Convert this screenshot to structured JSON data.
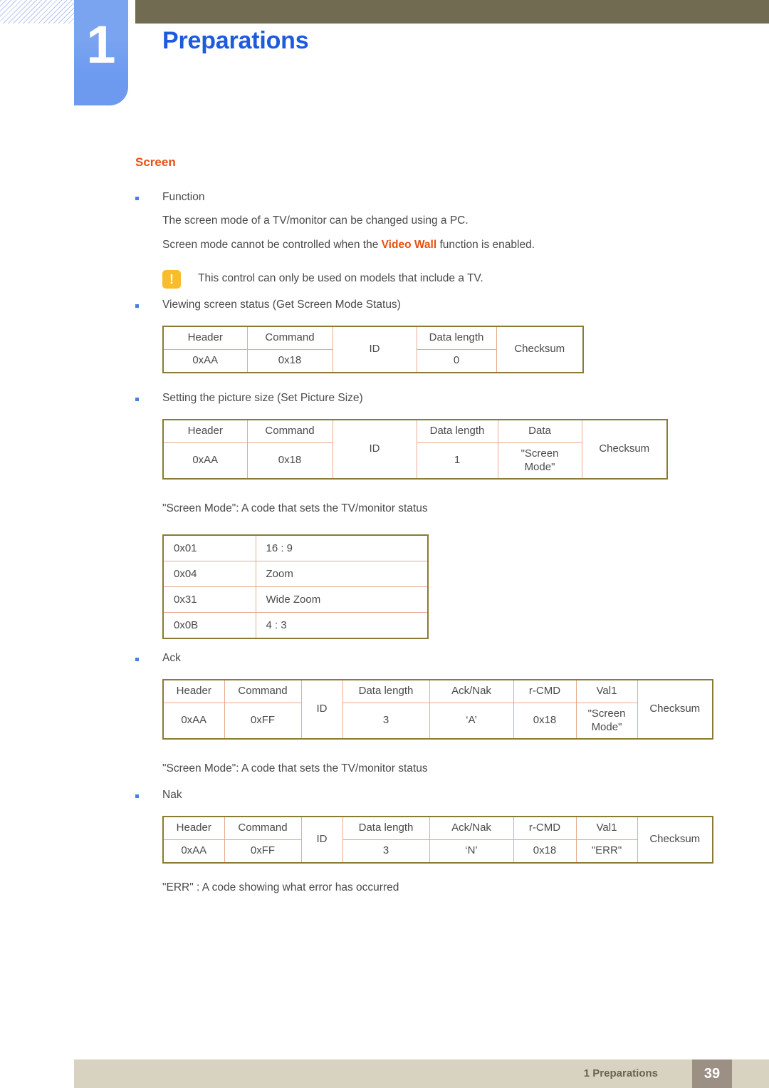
{
  "header": {
    "chapter_number": "1",
    "chapter_title": "Preparations",
    "olive_bar_color": "#716b52",
    "tab_color": "#7ba4f0",
    "title_color": "#1c5ae0"
  },
  "section": {
    "title": "Screen",
    "title_color": "#e8500f"
  },
  "body": {
    "function_bullet": "Function",
    "function_line1": "The screen mode of a TV/monitor can be changed using a PC.",
    "function_line2_pre": "Screen mode cannot be controlled when the ",
    "function_line2_hl": "Video Wall",
    "function_line2_post": " function is enabled.",
    "note_icon": "!",
    "note_text": "This control can only be used on models that include a TV.",
    "get_status_bullet": "Viewing screen status (Get Screen Mode Status)",
    "set_size_bullet": "Setting the picture size (Set Picture Size)",
    "screen_mode_caption": "\"Screen Mode\": A code that sets the TV/monitor status",
    "ack_bullet": "Ack",
    "ack_caption": "\"Screen Mode\": A code that sets the TV/monitor status",
    "nak_bullet": "Nak",
    "nak_caption": "\"ERR\" : A code showing what error has occurred"
  },
  "table_get_status": {
    "headers": [
      "Header",
      "Command",
      "ID",
      "Data length",
      "Checksum"
    ],
    "values": [
      "0xAA",
      "0x18",
      "ID",
      "0",
      "Checksum"
    ]
  },
  "table_set_size": {
    "headers": [
      "Header",
      "Command",
      "ID",
      "Data length",
      "Data",
      "Checksum"
    ],
    "values": [
      "0xAA",
      "0x18",
      "ID",
      "1",
      "\"Screen Mode\"",
      "Checksum"
    ],
    "data_cell_line1": "\"Screen",
    "data_cell_line2": "Mode\""
  },
  "table_screen_mode_codes": {
    "rows": [
      {
        "code": "0x01",
        "name": "16 : 9"
      },
      {
        "code": "0x04",
        "name": "Zoom"
      },
      {
        "code": "0x31",
        "name": "Wide Zoom"
      },
      {
        "code": "0x0B",
        "name": "4 : 3"
      }
    ]
  },
  "table_ack": {
    "headers": [
      "Header",
      "Command",
      "ID",
      "Data length",
      "Ack/Nak",
      "r-CMD",
      "Val1",
      "Checksum"
    ],
    "values": [
      "0xAA",
      "0xFF",
      "ID",
      "3",
      "‘A’",
      "0x18",
      "\"Screen Mode\"",
      "Checksum"
    ],
    "val1_line1": "\"Screen",
    "val1_line2": "Mode\""
  },
  "table_nak": {
    "headers": [
      "Header",
      "Command",
      "ID",
      "Data length",
      "Ack/Nak",
      "r-CMD",
      "Val1",
      "Checksum"
    ],
    "values": [
      "0xAA",
      "0xFF",
      "ID",
      "3",
      "‘N’",
      "0x18",
      "\"ERR\"",
      "Checksum"
    ]
  },
  "footer": {
    "label": "1 Preparations",
    "page_number": "39",
    "band_color": "#d8d3c0",
    "page_box_color": "#9c8f84"
  }
}
